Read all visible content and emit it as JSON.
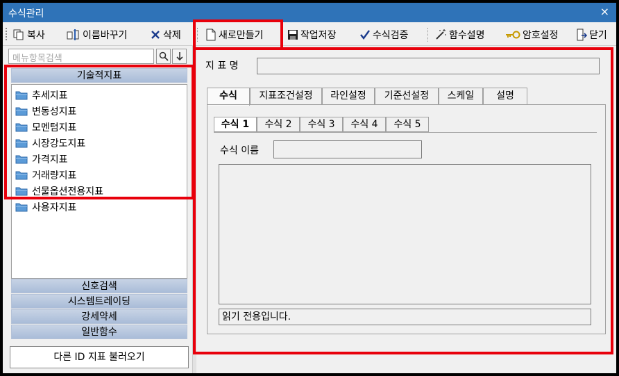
{
  "window": {
    "title": "수식관리",
    "close": "×"
  },
  "toolbar": {
    "copy": "복사",
    "rename": "이름바꾸기",
    "delete": "삭제",
    "new": "새로만들기",
    "save": "작업저장",
    "verify": "수식검증",
    "func_desc": "함수설명",
    "password": "암호설정",
    "close": "닫기"
  },
  "sidebar": {
    "search_placeholder": "메뉴항목검색",
    "categories": {
      "technical": "기술적지표",
      "signal": "신호검색",
      "system": "시스템트레이딩",
      "strength": "강세약세",
      "general": "일반함수"
    },
    "tree": [
      "추세지표",
      "변동성지표",
      "모멘텀지표",
      "시장강도지표",
      "가격지표",
      "거래량지표",
      "선물옵션전용지표",
      "사용자지표"
    ],
    "load_other_id": "다른 ID 지표 불러오기"
  },
  "main": {
    "indicator_name_label": "지 표 명",
    "indicator_name_value": "",
    "tabs": [
      "수식",
      "지표조건설정",
      "라인설정",
      "기준선설정",
      "스케일",
      "설명"
    ],
    "formula_tabs": [
      "수식 1",
      "수식 2",
      "수식 3",
      "수식 4",
      "수식 5"
    ],
    "formula_name_label": "수식 이름",
    "formula_name_value": "",
    "status_text": "읽기 전용입니다."
  },
  "colors": {
    "highlight": "#e8000b",
    "titlebar": "#2f73b8",
    "category_header": "#b8c8df"
  }
}
